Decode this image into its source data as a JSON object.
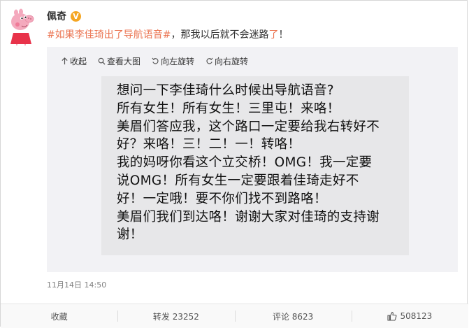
{
  "user": {
    "name": "佩奇",
    "verified_badge": "V"
  },
  "post": {
    "hashtag": "#如果李佳琦出了导航语音#",
    "text_before_highlight": "，那我以后就不会迷路",
    "highlight": "了",
    "text_end": "！",
    "time": "11月14日 14:50"
  },
  "media_toolbar": {
    "collapse": "收起",
    "view_large": "查看大图",
    "rotate_left": "向左旋转",
    "rotate_right": "向右旋转"
  },
  "image_text": {
    "lines": [
      "想问一下李佳琦什么时候出导航语音?",
      "所有女生！所有女生！三里屯！来咯！",
      "美眉们答应我，这个路口一定要给我右转好不",
      "好？来咯！三！二！一！转咯！",
      "我的妈呀你看这个立交桥！OMG！我一定要",
      "说OMG！所有女生一定要跟着佳琦走好不",
      "好！一定哦！要不你们找不到路咯！",
      "美眉们我们到达咯！谢谢大家对佳琦的支持谢",
      "谢！"
    ]
  },
  "actions": {
    "favorite": "收藏",
    "repost": "转发 23252",
    "comment": "评论 8623",
    "like_count": "508123"
  },
  "colors": {
    "link": "#eb7350",
    "verified": "#f5a623",
    "avatar_pink": "#f4a9bd"
  }
}
